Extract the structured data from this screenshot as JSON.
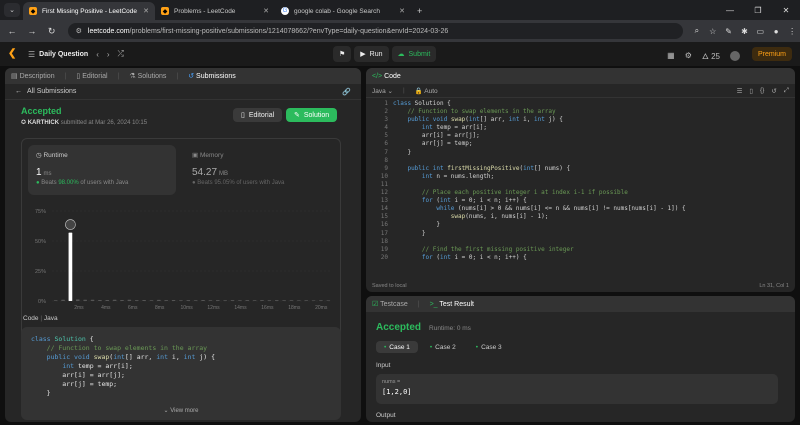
{
  "browser": {
    "tabs": [
      {
        "title": "First Missing Positive - LeetCode",
        "active": true
      },
      {
        "title": "Problems - LeetCode",
        "active": false
      },
      {
        "title": "google colab - Google Search",
        "active": false
      }
    ],
    "url_domain": "leetcode.com",
    "url_path": "/problems/first-missing-positive/submissions/1214078662/?envType=daily-question&envId=2024-03-26"
  },
  "nav": {
    "title": "Daily Question",
    "run_label": "Run",
    "submit_label": "Submit",
    "streak": "25",
    "premium_label": "Premium"
  },
  "left": {
    "tabs": [
      "Description",
      "Editorial",
      "Solutions",
      "Submissions"
    ],
    "all_submissions": "All Submissions",
    "status": "Accepted",
    "user": "KARTHICK",
    "submitted": "submitted at Mar 26, 2024 10:15",
    "editorial_btn": "Editorial",
    "solution_btn": "Solution",
    "runtime_label": "Runtime",
    "runtime_value": "1",
    "runtime_unit": "ms",
    "runtime_beats_prefix": "Beats",
    "runtime_beats": "98.00%",
    "runtime_beats_suffix": "of users with Java",
    "memory_label": "Memory",
    "memory_value": "54.27",
    "memory_unit": "MB",
    "memory_beats_prefix": "Beats",
    "memory_beats": "95.05%",
    "memory_beats_suffix": "of users with Java",
    "code_label": "Code",
    "code_lang": "Java",
    "view_more": "View more"
  },
  "chart_data": {
    "type": "bar",
    "ylim": [
      0,
      75
    ],
    "ytick_labels": [
      "75%",
      "50%",
      "25%",
      "0%"
    ],
    "xtick_labels": [
      "2ms",
      "4ms",
      "6ms",
      "8ms",
      "10ms",
      "12ms",
      "14ms",
      "16ms",
      "18ms",
      "20ms"
    ],
    "mini_tick_labels": [
      "5ms",
      "10ms",
      "15ms",
      "20ms"
    ],
    "values": [
      0.6,
      1.0,
      57,
      1.2,
      1.0,
      1.0,
      0.8,
      0.8,
      1.0,
      0.8,
      1.0,
      0.7,
      0.8,
      0.6,
      0.9,
      0.7,
      0.8,
      0.6,
      0.7,
      0.6,
      0.8,
      0.6,
      0.7,
      0.6,
      0.7,
      0.6,
      0.7,
      0.6,
      0.7,
      0.6,
      0.7,
      0.6,
      0.6,
      0.5,
      0.6,
      0.5,
      0.6,
      0.5
    ],
    "highlight_index": 2
  },
  "code": {
    "header": "Code",
    "lang": "Java",
    "auto": "Auto",
    "saved": "Saved to local",
    "position": "Ln 31, Col 1",
    "lines": [
      "class Solution {",
      "    // Function to swap elements in the array",
      "    public void swap(int[] arr, int i, int j) {",
      "        int temp = arr[i];",
      "        arr[i] = arr[j];",
      "        arr[j] = temp;",
      "    }",
      "",
      "    public int firstMissingPositive(int[] nums) {",
      "        int n = nums.length;",
      "",
      "        // Place each positive integer i at index i-1 if possible",
      "        for (int i = 0; i < n; i++) {",
      "            while (nums[i] > 0 && nums[i] <= n && nums[i] != nums[nums[i] - 1]) {",
      "                swap(nums, i, nums[i] - 1);",
      "            }",
      "        }",
      "",
      "        // Find the first missing positive integer",
      "        for (int i = 0; i < n; i++) {"
    ],
    "line_numbers": [
      "1",
      "2",
      "3",
      "4",
      "5",
      "6",
      "7",
      "8",
      "9",
      "10",
      "11",
      "12",
      "13",
      "14",
      "15",
      "16",
      "17",
      "18",
      "19",
      "20"
    ]
  },
  "result": {
    "tab_testcase": "Testcase",
    "tab_result": "Test Result",
    "status": "Accepted",
    "runtime": "Runtime: 0 ms",
    "cases": [
      "Case 1",
      "Case 2",
      "Case 3"
    ],
    "input_label": "Input",
    "input_name": "nums =",
    "input_value": "[1,2,0]",
    "output_label": "Output"
  },
  "colors": {
    "accent": "#ffa116",
    "green": "#2cbb5d"
  }
}
